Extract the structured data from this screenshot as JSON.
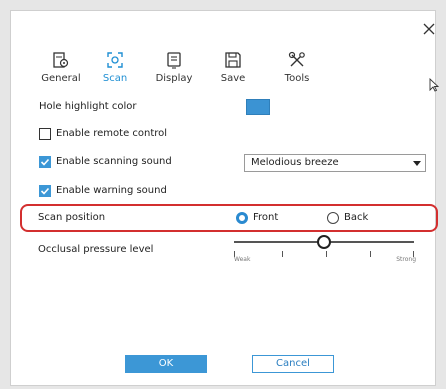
{
  "tabs": [
    {
      "label": "General",
      "icon": "general-icon"
    },
    {
      "label": "Scan",
      "icon": "scan-icon",
      "active": true
    },
    {
      "label": "Display",
      "icon": "display-icon"
    },
    {
      "label": "Save",
      "icon": "save-icon"
    },
    {
      "label": "Tools",
      "icon": "tools-icon"
    }
  ],
  "settings": {
    "hole_highlight_color": {
      "label": "Hole highlight color",
      "color": "#3b93d3"
    },
    "remote_control": {
      "label": "Enable remote control",
      "checked": false
    },
    "scanning_sound": {
      "label": "Enable scanning sound",
      "checked": true,
      "value": "Melodious breeze"
    },
    "warning_sound": {
      "label": "Enable warning sound",
      "checked": true
    },
    "scan_position": {
      "label": "Scan position",
      "options": [
        "Front",
        "Back"
      ],
      "selected": "Front"
    },
    "occlusal_pressure": {
      "label": "Occlusal pressure level",
      "min_label": "Weak",
      "max_label": "Strong",
      "level_fraction": 0.5
    }
  },
  "buttons": {
    "ok": "OK",
    "cancel": "Cancel"
  },
  "colors": {
    "accent": "#3c97d6",
    "highlight_border": "#d32f2f"
  }
}
